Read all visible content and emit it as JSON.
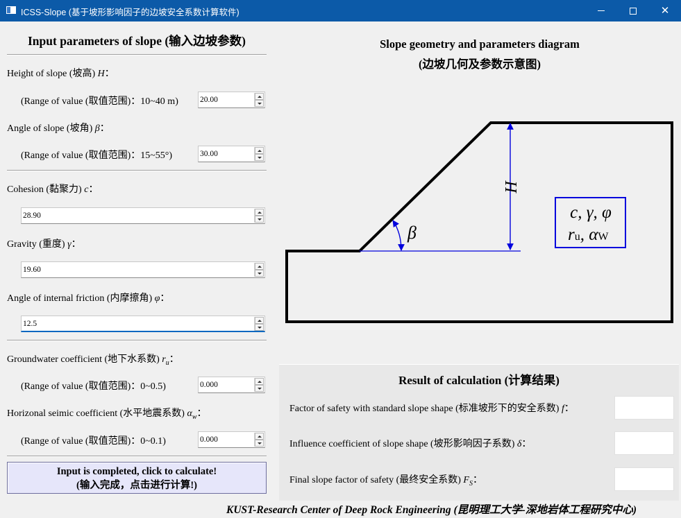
{
  "window": {
    "title": "ICSS-Slope (基于坡形影响因子的边坡安全系数计算软件)"
  },
  "input_panel": {
    "heading": "Input parameters of slope (输入边坡参数)",
    "height": {
      "label": "Height of slope (坡高) ",
      "symbol": "H",
      "suffix": "：",
      "range_label": "(Range of value (取值范围)：10~40 m)",
      "value": "20.00"
    },
    "angle": {
      "label": "Angle of slope (坡角) ",
      "symbol": "β",
      "suffix": "：",
      "range_label": "(Range of value (取值范围)：15~55°)",
      "value": "30.00"
    },
    "cohesion": {
      "label": "Cohesion (黏聚力) ",
      "symbol": "c",
      "suffix": "：",
      "value": "28.90"
    },
    "gravity": {
      "label": "Gravity (重度) ",
      "symbol": "γ",
      "suffix": "：",
      "value": "19.60"
    },
    "friction": {
      "label": "Angle of internal friction (内摩擦角) ",
      "symbol": "φ",
      "suffix": "：",
      "value": "12.5"
    },
    "groundwater": {
      "label": "Groundwater coefficient (地下水系数) ",
      "symbol": "r",
      "symbol_sub": "u",
      "suffix": "：",
      "range_label": "(Range of value (取值范围)：0~0.5)",
      "value": "0.000"
    },
    "seismic": {
      "label": "Horizonal seimic coefficient (水平地震系数) ",
      "symbol": "α",
      "symbol_sub": "w",
      "suffix": "：",
      "range_label": "(Range of value (取值范围)：0~0.1)",
      "value": "0.000"
    },
    "calculate_button": {
      "line1": "Input is completed, click to calculate!",
      "line2": "(输入完成，点击进行计算!)"
    }
  },
  "diagram": {
    "title_line1": "Slope geometry and parameters diagram",
    "title_line2": "(边坡几何及参数示意图)",
    "height_label": "H",
    "angle_label": "β",
    "params_line1": "c, γ, φ",
    "params_line2_a": "r",
    "params_line2_a_sub": "u",
    "params_line2_b": ", α",
    "params_line2_b_sub": "W",
    "accent_color": "#0000dd"
  },
  "results": {
    "heading": "Result of calculation (计算结果)",
    "fs_standard": {
      "label": "Factor of safety with standard slope shape (标准坡形下的安全系数) ",
      "symbol": "f",
      "suffix": "：",
      "value": ""
    },
    "influence": {
      "label": "Influence coefficient of slope shape (坡形影响因子系数) ",
      "symbol": "δ",
      "suffix": "：",
      "value": ""
    },
    "final": {
      "label": "Final slope factor of safety (最终安全系数) ",
      "symbol": "F",
      "symbol_sub": "S",
      "suffix": "：",
      "value": ""
    }
  },
  "footer": {
    "text": "KUST-Research Center of Deep Rock Engineering (昆明理工大学-深地岩体工程研究中心)"
  }
}
